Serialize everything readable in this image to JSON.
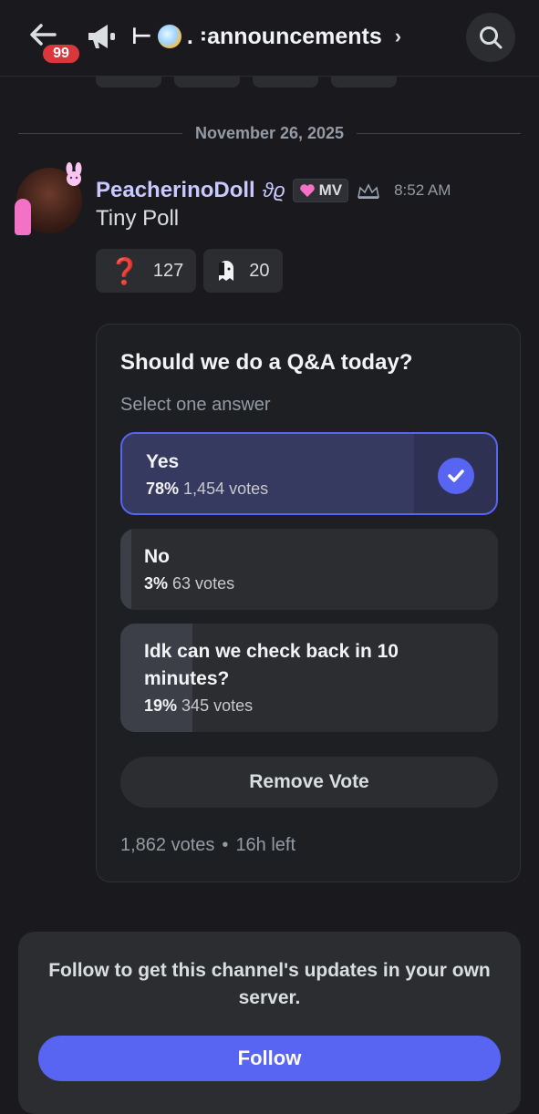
{
  "header": {
    "notification_count": "99",
    "channel_prefix": "⊢",
    "channel_name": ". ꞉announcements",
    "chevron": "›"
  },
  "date_divider": "November 26, 2025",
  "message": {
    "username": "PeacherinoDoll",
    "user_glyph": "ϑϱ",
    "tag": "MV",
    "timestamp": "8:52 AM",
    "content": "Tiny Poll",
    "reactions": [
      {
        "emoji": "❓",
        "count": "127"
      },
      {
        "emoji": "ghost-emoji",
        "count": "20"
      }
    ]
  },
  "poll": {
    "question": "Should we do a Q&A today?",
    "instruction": "Select one answer",
    "answers": [
      {
        "label": "Yes",
        "percent": "78%",
        "votes": "1,454 votes",
        "fill": 78,
        "selected": true
      },
      {
        "label": "No",
        "percent": "3%",
        "votes": "63 votes",
        "fill": 3,
        "selected": false
      },
      {
        "label": "Idk can we check back in 10 minutes?",
        "percent": "19%",
        "votes": "345 votes",
        "fill": 19,
        "selected": false
      }
    ],
    "remove_vote_label": "Remove Vote",
    "total_votes": "1,862 votes",
    "separator": "•",
    "time_left": "16h left"
  },
  "follow": {
    "text": "Follow to get this channel's updates in your own server.",
    "button_label": "Follow"
  },
  "colors": {
    "accent": "#5865f2",
    "badge": "#da373c",
    "username": "#c7c9ff"
  }
}
